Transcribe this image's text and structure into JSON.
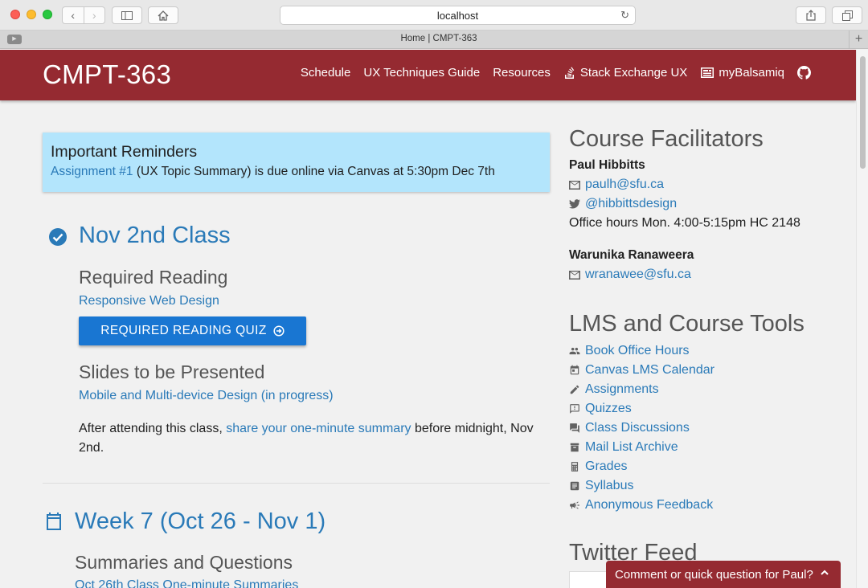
{
  "browser": {
    "url": "localhost",
    "tab_title": "Home | CMPT-363"
  },
  "site": {
    "brand": "CMPT-363",
    "nav": {
      "schedule": "Schedule",
      "ux_guide": "UX Techniques Guide",
      "resources": "Resources",
      "stack_exchange": "Stack Exchange UX",
      "mybalsamiq": "myBalsamiq"
    }
  },
  "reminders": {
    "title": "Important Reminders",
    "link": "Assignment #1",
    "text": "(UX Topic Summary) is due online via Canvas at 5:30pm Dec 7th"
  },
  "class": {
    "title": "Nov 2nd Class",
    "reading_heading": "Required Reading",
    "reading_link": "Responsive Web Design",
    "quiz_button": "REQUIRED READING QUIZ",
    "slides_heading": "Slides to be Presented",
    "slides_link": "Mobile and Multi-device Design (in progress)",
    "after_pre": "After attending this class, ",
    "after_link": "share your one-minute summary",
    "after_post": " before midnight, Nov 2nd."
  },
  "week": {
    "title": "Week 7 (Oct 26 - Nov 1)",
    "summaries_heading": "Summaries and Questions",
    "summaries_link": "Oct 26th Class One-minute Summaries"
  },
  "facilitators": {
    "heading": "Course Facilitators",
    "paul": {
      "name": "Paul Hibbitts",
      "email": "paulh@sfu.ca",
      "twitter": "@hibbittsdesign",
      "office_hours": "Office hours Mon. 4:00-5:15pm HC 2148"
    },
    "warunika": {
      "name": "Warunika Ranaweera",
      "email": "wranawee@sfu.ca"
    }
  },
  "tools": {
    "heading": "LMS and Course Tools",
    "items": [
      {
        "label": "Book Office Hours",
        "icon": "people-icon"
      },
      {
        "label": "Canvas LMS Calendar",
        "icon": "calendar-icon"
      },
      {
        "label": "Assignments",
        "icon": "pencil-icon"
      },
      {
        "label": "Quizzes",
        "icon": "feedback-icon"
      },
      {
        "label": "Class Discussions",
        "icon": "forum-icon"
      },
      {
        "label": "Mail List Archive",
        "icon": "archive-icon"
      },
      {
        "label": "Grades",
        "icon": "calculator-icon"
      },
      {
        "label": "Syllabus",
        "icon": "document-icon"
      },
      {
        "label": "Anonymous Feedback",
        "icon": "megaphone-icon"
      }
    ]
  },
  "twitter_feed": {
    "heading": "Twitter Feed"
  },
  "feedback_tab": {
    "label": "Comment or quick question for Paul?"
  },
  "colors": {
    "header": "#952a31",
    "link": "#2a7ab8",
    "reminder_bg": "#b3e5fc",
    "button": "#1976d2"
  }
}
